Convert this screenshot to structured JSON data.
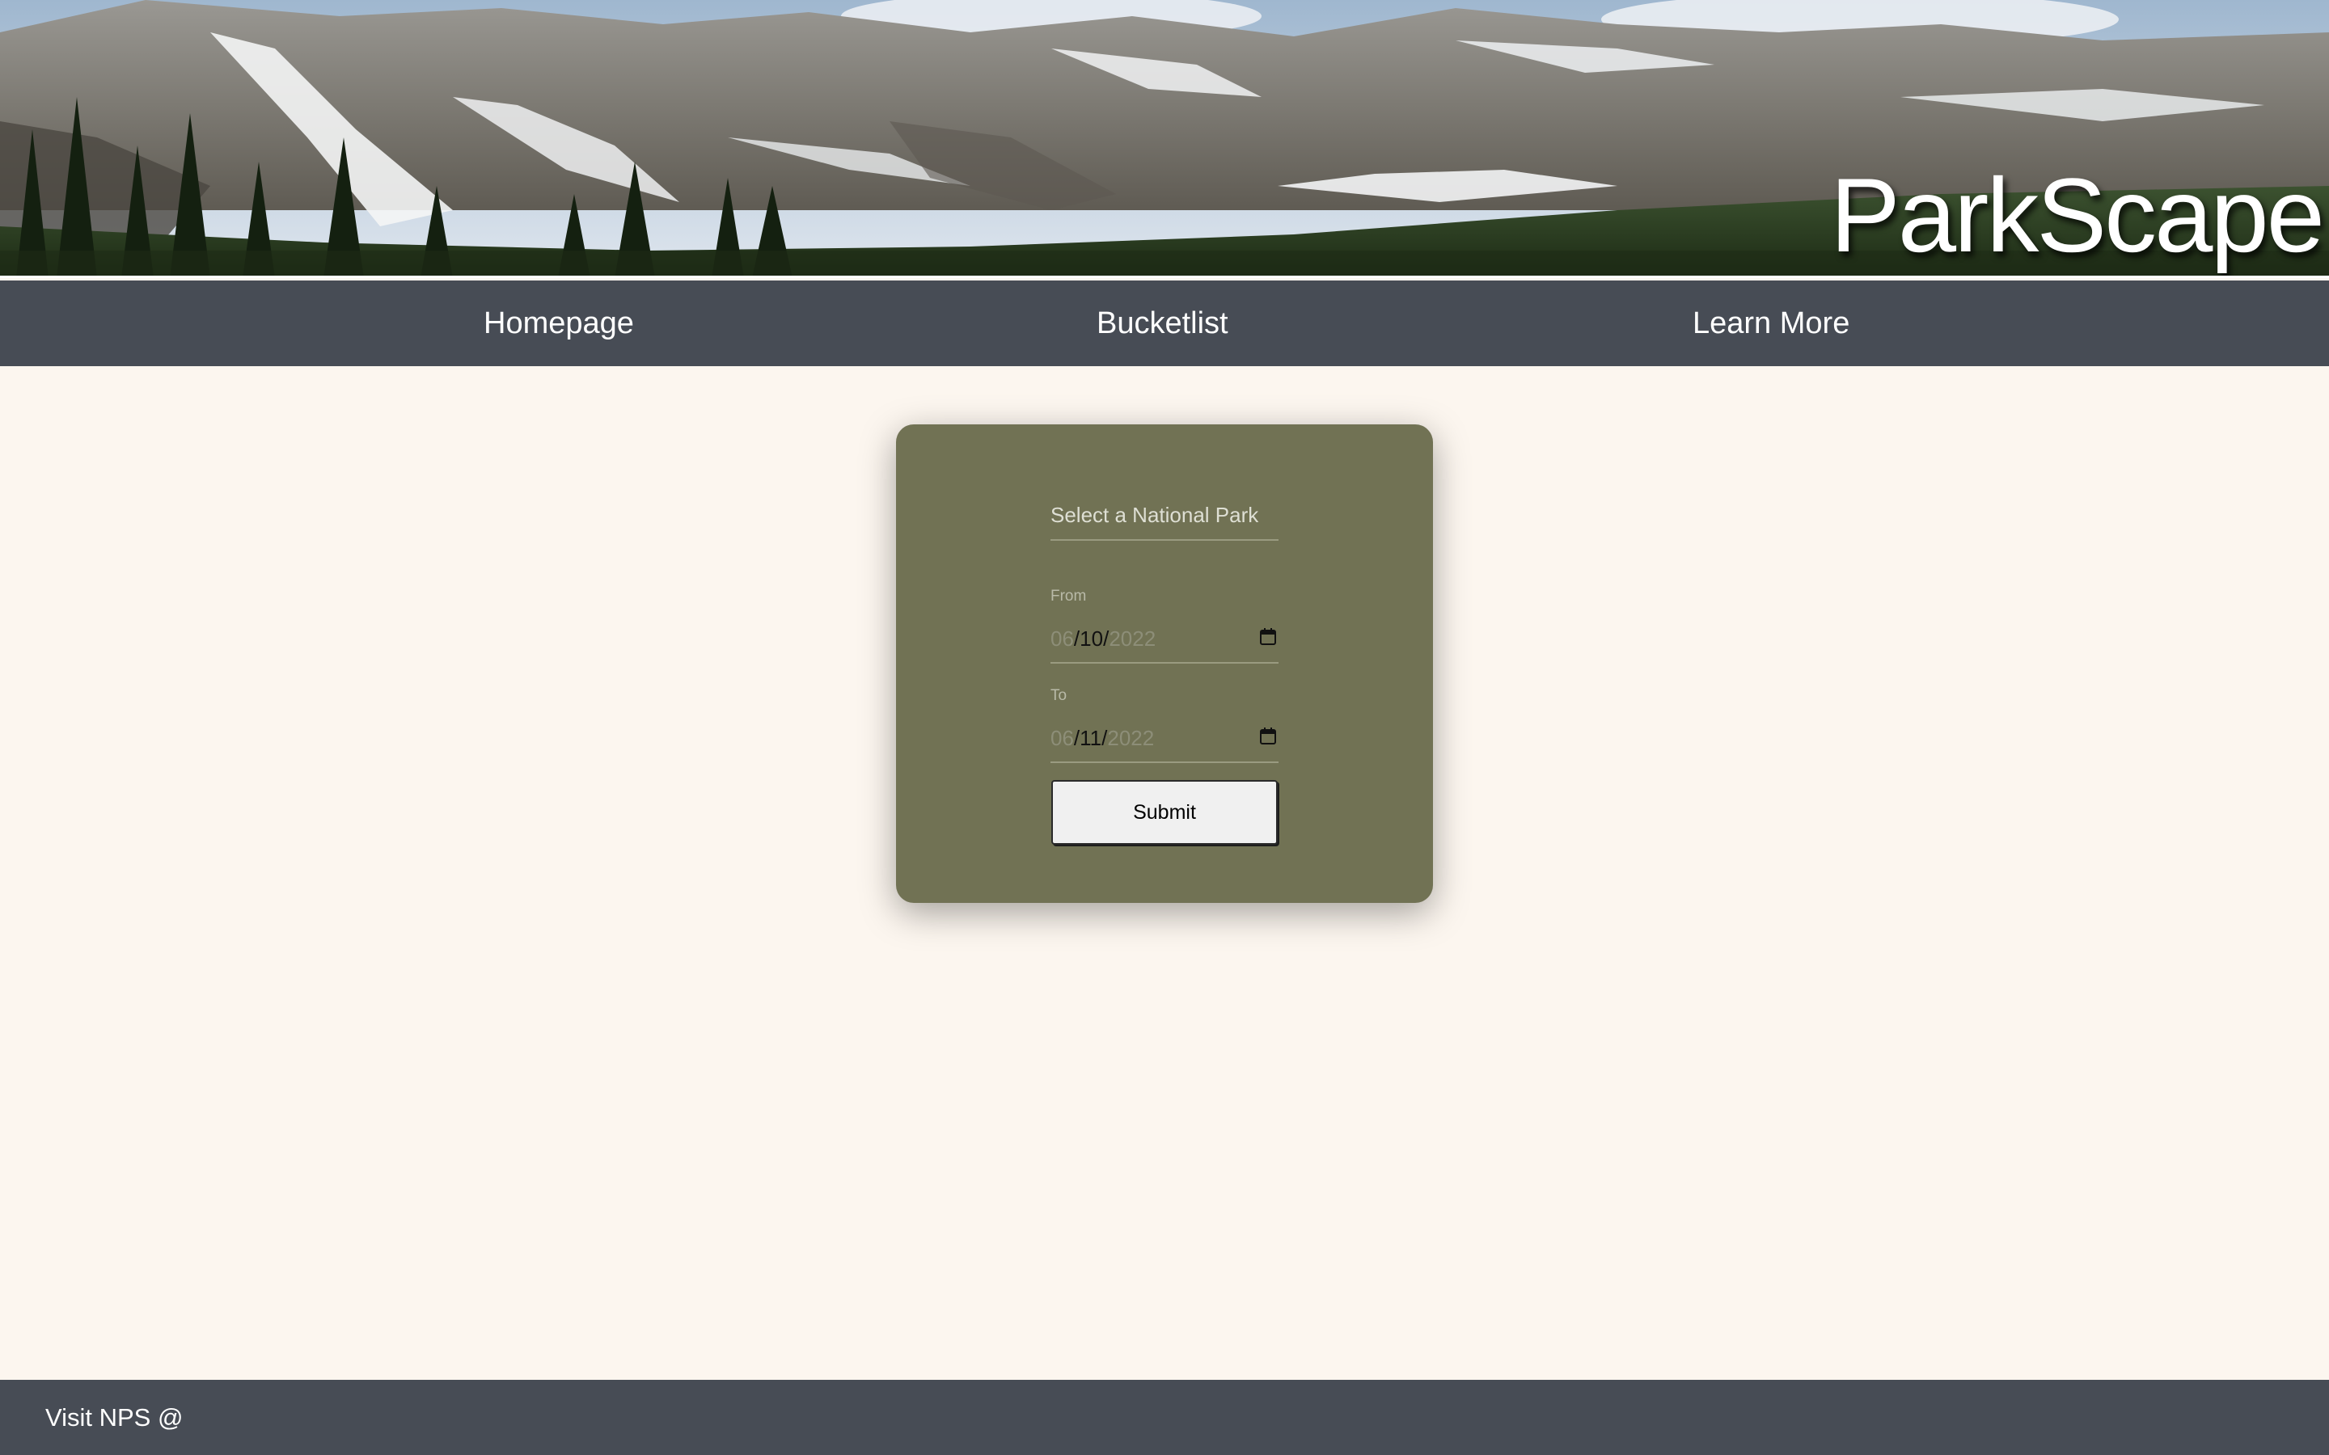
{
  "header": {
    "site_title": "ParkScape",
    "banner_image": "mountain-landscape"
  },
  "nav": {
    "items": [
      {
        "label": "Homepage"
      },
      {
        "label": "Bucketlist"
      },
      {
        "label": "Learn More"
      }
    ]
  },
  "form": {
    "park_placeholder": "Select a National Park",
    "from_label": "From",
    "from_date": {
      "month": "06",
      "day": "10",
      "year": "2022"
    },
    "to_label": "To",
    "to_date": {
      "month": "06",
      "day": "11",
      "year": "2022"
    },
    "calendar_icon": "calendar-icon",
    "submit_label": "Submit"
  },
  "footer": {
    "text": "Visit NPS @"
  },
  "colors": {
    "page_background": "#fcf6ef",
    "nav_background": "#474c55",
    "card_background": "#717254",
    "button_background": "#f0f0f0"
  }
}
